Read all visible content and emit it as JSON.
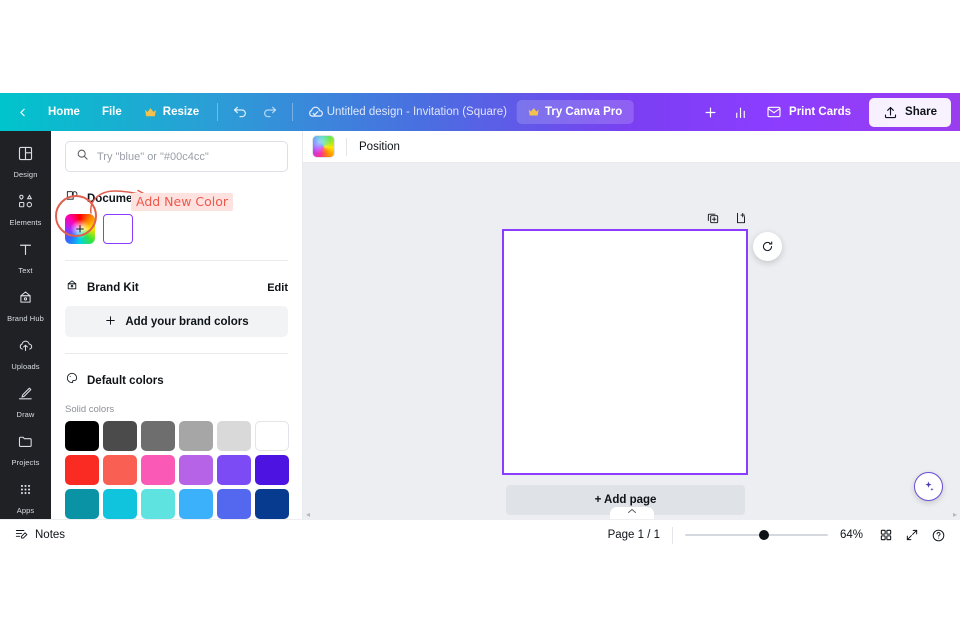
{
  "topbar": {
    "back_icon": "chevron-left-icon",
    "home_label": "Home",
    "file_label": "File",
    "resize_label": "Resize",
    "resize_icon": "crown-icon",
    "undo_icon": "undo-icon",
    "redo_icon": "redo-icon",
    "cloud_icon": "cloud-saved-icon",
    "doc_title": "Untitled design - Invitation (Square)",
    "pro_label": "Try Canva Pro",
    "pro_icon": "crown-icon",
    "add_icon": "plus-icon",
    "insights_icon": "bar-chart-icon",
    "print_label": "Print Cards",
    "print_icon": "envelope-icon",
    "share_label": "Share",
    "share_icon": "upload-icon",
    "gradient_start": "#00c4cc",
    "gradient_end": "#8b3dff"
  },
  "rail": {
    "items": [
      {
        "label": "Design",
        "icon": "layout-icon"
      },
      {
        "label": "Elements",
        "icon": "shapes-icon"
      },
      {
        "label": "Text",
        "icon": "text-t-icon"
      },
      {
        "label": "Brand Hub",
        "icon": "brand-hub-icon"
      },
      {
        "label": "Uploads",
        "icon": "upload-cloud-icon"
      },
      {
        "label": "Draw",
        "icon": "pen-icon"
      },
      {
        "label": "Projects",
        "icon": "folder-icon"
      },
      {
        "label": "Apps",
        "icon": "grid-dots-icon"
      }
    ]
  },
  "panel": {
    "search": {
      "placeholder": "Try \"blue\" or \"#00c4cc\"",
      "value": "",
      "icon": "search-icon"
    },
    "document_colors": {
      "title": "Document colors",
      "icon": "document-colors-icon",
      "add_swatch": "rainbow-add-swatch",
      "swatches": [
        "#ffffff"
      ]
    },
    "brand_kit": {
      "title": "Brand Kit",
      "icon": "brand-kit-icon",
      "edit_label": "Edit",
      "add_label": "Add your brand colors",
      "add_icon": "plus-icon"
    },
    "default_colors": {
      "title": "Default colors",
      "icon": "palette-icon",
      "solid_label": "Solid colors",
      "rows": [
        [
          "#000000",
          "#4b4b4b",
          "#6e6e6e",
          "#a6a6a6",
          "#d9d9d9",
          "#ffffff"
        ],
        [
          "#fa2b23",
          "#f95f52",
          "#fa5ab5",
          "#b763e8",
          "#7d4bf5",
          "#4d13e0"
        ],
        [
          "#0a93a5",
          "#10c4de",
          "#5ee3e0",
          "#3bb0fb",
          "#5468ef",
          "#063b8f"
        ],
        [
          "#00b757",
          "#74ce52",
          "#abfb72",
          "#ffd951",
          "#fcb94d",
          "#fb8a3f"
        ]
      ]
    },
    "annotation": {
      "text": "Add New Color",
      "text_color": "#f0584a",
      "highlight_color": "#fde2e0",
      "circle_color": "#e0604f",
      "shapes": [
        "highlight-circle",
        "curved-arrow"
      ]
    }
  },
  "editor": {
    "position_bar": {
      "swatch": "rainbow-gradient-swatch",
      "label": "Position"
    },
    "canvas": {
      "selection_color": "#8b3dff",
      "duplicate_icon": "duplicate-page-icon",
      "addpage_icon": "add-page-icon",
      "rotate_icon": "rotate-icon",
      "add_page_label": "+ Add page",
      "magic_icon": "magic-sparkle-icon"
    }
  },
  "bottombar": {
    "notes_label": "Notes",
    "notes_icon": "notes-icon",
    "page_count": "Page 1 / 1",
    "zoom_value": "64%",
    "grid_icon": "grid-view-icon",
    "fullscreen_icon": "fullscreen-icon",
    "help_icon": "help-circle-icon"
  }
}
